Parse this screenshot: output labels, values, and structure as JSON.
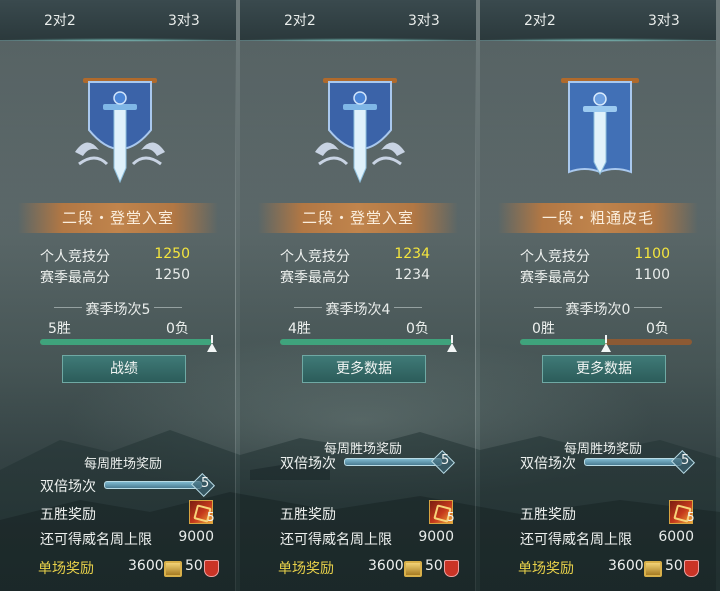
{
  "panels": [
    {
      "tabs": [
        "2对2",
        "3对3"
      ],
      "rank": "二段・登堂入室",
      "emblem": "sword-banner-tier2-icon",
      "personal_score_label": "个人竞技分",
      "personal_score": "1250",
      "season_high_label": "赛季最高分",
      "season_high": "1250",
      "season_matches": "赛季场次5",
      "wins": "5胜",
      "losses": "0负",
      "win_ratio": 1.0,
      "button": "战绩",
      "weekly_title": "每周胜场奖励",
      "double_label": "双倍场次",
      "double_count": "5",
      "five_wins_label": "五胜奖励",
      "five_wins_count": "5",
      "weekly_cap_label": "还可得威名周上限",
      "weekly_cap": "9000",
      "single_reward_label": "单场奖励",
      "coin_reward": "3600",
      "shield_reward": "50"
    },
    {
      "tabs": [
        "2对2",
        "3对3"
      ],
      "rank": "二段・登堂入室",
      "emblem": "sword-banner-tier2-icon",
      "personal_score_label": "个人竞技分",
      "personal_score": "1234",
      "season_high_label": "赛季最高分",
      "season_high": "1234",
      "season_matches": "赛季场次4",
      "wins": "4胜",
      "losses": "0负",
      "win_ratio": 1.0,
      "button": "更多数据",
      "weekly_title": "每周胜场奖励",
      "double_label": "双倍场次",
      "double_count": "5",
      "five_wins_label": "五胜奖励",
      "five_wins_count": "5",
      "weekly_cap_label": "还可得威名周上限",
      "weekly_cap": "9000",
      "single_reward_label": "单场奖励",
      "coin_reward": "3600",
      "shield_reward": "50"
    },
    {
      "tabs": [
        "2对2",
        "3对3"
      ],
      "rank": "一段・粗通皮毛",
      "emblem": "sword-banner-tier1-icon",
      "personal_score_label": "个人竞技分",
      "personal_score": "1100",
      "season_high_label": "赛季最高分",
      "season_high": "1100",
      "season_matches": "赛季场次0",
      "wins": "0胜",
      "losses": "0负",
      "win_ratio": 0.5,
      "button": "更多数据",
      "weekly_title": "每周胜场奖励",
      "double_label": "双倍场次",
      "double_count": "5",
      "five_wins_label": "五胜奖励",
      "five_wins_count": "5",
      "weekly_cap_label": "还可得威名周上限",
      "weekly_cap": "6000",
      "single_reward_label": "单场奖励",
      "coin_reward": "3600",
      "shield_reward": "50"
    }
  ],
  "colors": {
    "score_highlight": "#f4e53e",
    "win_bar": "#3fa37c",
    "loss_bar": "#8c5a34",
    "rank_banner": "#c0844c",
    "button": "#2c5c5a"
  }
}
